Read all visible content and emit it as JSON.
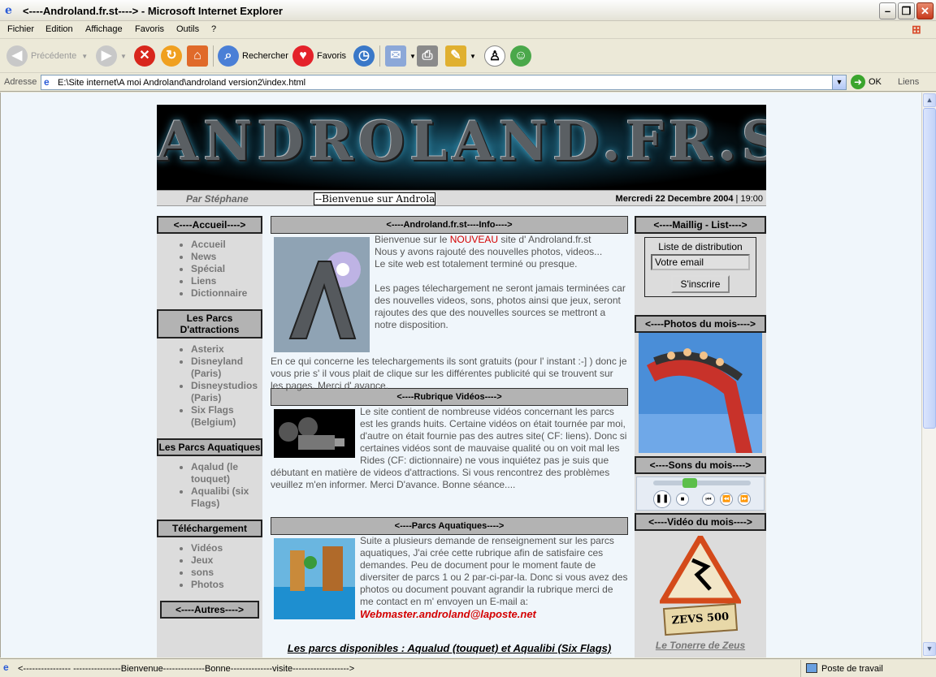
{
  "window": {
    "title": "<----Androland.fr.st----> - Microsoft Internet Explorer",
    "min_icon": "minimize-icon",
    "max_icon": "maximize-icon",
    "close_icon": "close-icon"
  },
  "menu": {
    "items": [
      "Fichier",
      "Edition",
      "Affichage",
      "Favoris",
      "Outils",
      "?"
    ]
  },
  "toolbar": {
    "back": "Précédente",
    "search": "Rechercher",
    "favorites": "Favoris"
  },
  "address": {
    "label": "Adresse",
    "value": "E:\\Site internet\\A moi Androland\\androland version2\\index.html",
    "go": "OK",
    "links": "Liens"
  },
  "page": {
    "banner_logo": "ANDROLAND.FR.ST",
    "author": "Par Stéphane",
    "marquee": "--Bienvenue sur Androland",
    "date": "Mercredi 22 Decembre 2004",
    "time": "19:00",
    "left": {
      "accueil_title": "<----Accueil---->",
      "accueil_items": [
        "Accueil",
        "News",
        "Spécial",
        "Liens",
        "Dictionnaire"
      ],
      "parcs_title": "Les Parcs D'attractions",
      "parcs_items": [
        "Asterix",
        "Disneyland (Paris)",
        "Disneystudios (Paris)",
        "Six Flags (Belgium)"
      ],
      "aqua_title": "Les Parcs Aquatiques",
      "aqua_items": [
        "Aqalud (le touquet)",
        "Aqualibi (six Flags)"
      ],
      "dl_title": "Téléchargement",
      "dl_items": [
        "Vidéos",
        "Jeux",
        "sons",
        "Photos"
      ],
      "autres_title": "<----Autres---->"
    },
    "center": {
      "info_title": "<----Androland.fr.st----Info---->",
      "info_p1_a": "Bienvenue sur le ",
      "info_p1_new": "NOUVEAU",
      "info_p1_b": " site d' Androland.fr.st",
      "info_p2": "Nous y avons rajouté des nouvelles photos, videos...",
      "info_p3": "Le site web est totalement terminé ou presque.",
      "info_p4": "Les pages  télechargement ne seront jamais terminées car des nouvelles videos, sons, photos ainsi que jeux, seront rajoutes des que  des nouvelles sources se mettront a notre disposition.",
      "info_p5": "En ce qui concerne les telechargements ils sont gratuits (pour l' instant :-] ) donc je vous prie s' il vous plait de clique sur les différentes publicité qui se trouvent sur les pages. Merci d' avance.",
      "video_title": "<----Rubrique Vidéos---->",
      "video_text": "Le site contient de nombreuse vidéos concernant les parcs est les grands huits. Certaine vidéos on était tournée par moi, d'autre on était fournie pas des autres site( CF: liens). Donc si certaines vidéos sont de mauvaise qualité ou on voit mal les Rides (CF: dictionnaire) ne vous inquiétez pas je suis que débutant en matière de videos d'attractions. Si vous rencontrez des problèmes veuillez m'en informer. Merci D'avance. Bonne séance....",
      "aqua_title": "<----Parcs Aquatiques---->",
      "aqua_text": "Suite a plusieurs demande de renseignement sur les parcs aquatiques, J'ai crée cette rubrique afin de satisfaire ces demandes. Peu de document pour le moment faute de diversiter de parcs 1 ou 2 par-ci-par-la. Donc si vous avez des photos ou document pouvant agrandir la rubrique merci de me contact en m' envoyen un E-mail a:",
      "email_link": "Webmaster.androland@laposte.net",
      "parcs_dispo": "Les parcs disponibles : Aqualud (touquet) et Aqualibi (Six Flags)"
    },
    "right": {
      "mailing_title": "<----Maillig - List---->",
      "mailing_label": "Liste de distribution",
      "email_value": "Votre email",
      "subscribe": "S'inscrire",
      "photos_title": "<----Photos du mois---->",
      "sons_title": "<----Sons du mois---->",
      "video_title": "<----Vidéo du mois---->",
      "video_sign": "ZEVS 500",
      "video_caption": "Le Tonerre de Zeus"
    }
  },
  "status": {
    "message": "<---------------- ----------------Bienvenue--------------Bonne--------------visite------------------->",
    "zone": "Poste de travail"
  },
  "colors": {
    "accent_red": "#d40000",
    "page_bg": "#f0f6fb",
    "sidebar_bg": "#dcdcdc",
    "heading_bg": "#b3b3b3"
  }
}
